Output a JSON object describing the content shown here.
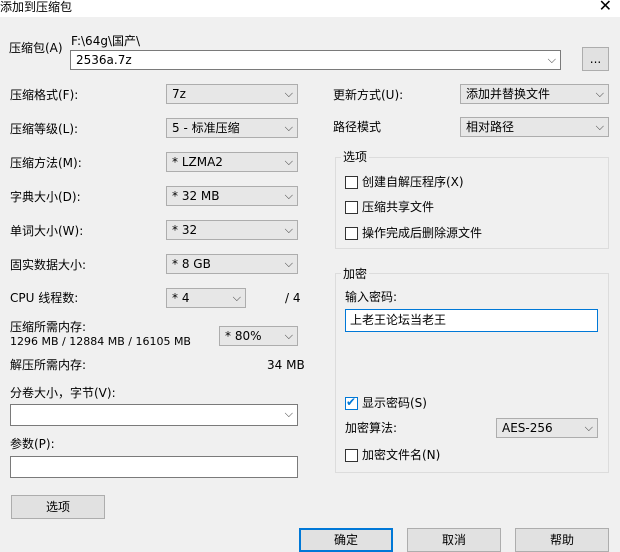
{
  "window": {
    "title": "添加到压缩包",
    "close_glyph": "✕"
  },
  "archive": {
    "label": "压缩包(A)",
    "folder": "F:\\64g\\国产\\",
    "name": "2536a.7z",
    "browse_label": "..."
  },
  "left": {
    "format": {
      "label": "压缩格式(F):",
      "value": "7z"
    },
    "level": {
      "label": "压缩等级(L):",
      "value": "5 - 标准压缩"
    },
    "method": {
      "label": "压缩方法(M):",
      "value": "* LZMA2"
    },
    "dict": {
      "label": "字典大小(D):",
      "value": "* 32 MB"
    },
    "word": {
      "label": "单词大小(W):",
      "value": "* 32"
    },
    "solid": {
      "label": "固实数据大小:",
      "value": "* 8 GB"
    },
    "cpu": {
      "label": "CPU 线程数:",
      "value": "* 4",
      "max": "/ 4"
    },
    "memory": {
      "label": "压缩所需内存:",
      "detail": "1296 MB / 12884 MB / 16105 MB",
      "value": "* 80%"
    },
    "decomp": {
      "label": "解压所需内存:",
      "value": "34 MB"
    },
    "volume": {
      "label": "分卷大小，字节(V):",
      "value": ""
    },
    "params": {
      "label": "参数(P):",
      "value": ""
    },
    "options_button": "选项"
  },
  "right": {
    "update": {
      "label": "更新方式(U):",
      "value": "添加并替换文件"
    },
    "path": {
      "label": "路径模式",
      "value": "相对路径"
    },
    "options": {
      "title": "选项",
      "sfx": "创建自解压程序(X)",
      "shared": "压缩共享文件",
      "delete": "操作完成后删除源文件"
    },
    "encrypt": {
      "title": "加密",
      "password_label": "输入密码:",
      "password": "上老王论坛当老王",
      "show_password": "显示密码(S)",
      "method_label": "加密算法:",
      "method": "AES-256",
      "encrypt_names": "加密文件名(N)"
    }
  },
  "footer": {
    "ok": "确定",
    "cancel": "取消",
    "help": "帮助"
  },
  "icons": {
    "dropdown": "⌵",
    "check": "✔"
  },
  "colors": {
    "accent": "#0078d7"
  }
}
